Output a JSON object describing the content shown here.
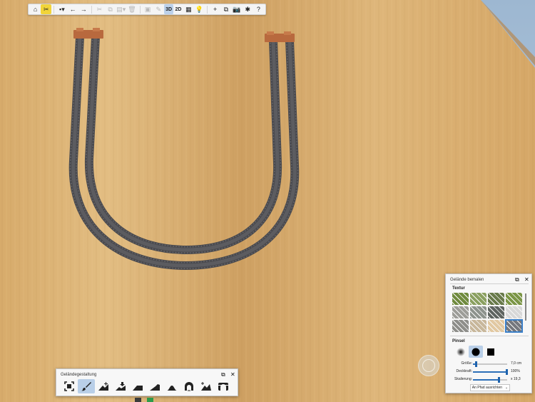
{
  "toolbar": {
    "items": [
      {
        "name": "home-icon",
        "glyph": "⌂"
      },
      {
        "name": "tools-icon",
        "glyph": "✂",
        "active": true
      },
      {
        "name": "save-icon",
        "glyph": "▪▾"
      },
      {
        "name": "undo-icon",
        "glyph": "←"
      },
      {
        "name": "redo-icon",
        "glyph": "→"
      },
      {
        "name": "cut-icon",
        "glyph": "✂"
      },
      {
        "name": "copy-icon",
        "glyph": "⧉"
      },
      {
        "name": "paste-icon",
        "glyph": "▤▾"
      },
      {
        "name": "delete-icon",
        "glyph": "🗑"
      },
      {
        "name": "group-icon",
        "glyph": "▣"
      },
      {
        "name": "pen-icon",
        "glyph": "✎"
      }
    ],
    "view_3d": "3D",
    "view_2d": "2D",
    "right_items": [
      {
        "name": "grid-icon",
        "glyph": "▦"
      },
      {
        "name": "bulb-icon",
        "glyph": "💡"
      },
      {
        "name": "add-icon",
        "glyph": "+"
      },
      {
        "name": "window-icon",
        "glyph": "⧉"
      },
      {
        "name": "camera-icon",
        "glyph": "📷"
      },
      {
        "name": "puzzle-icon",
        "glyph": "✱"
      },
      {
        "name": "help-icon",
        "glyph": "?"
      }
    ]
  },
  "terrain_panel": {
    "title": "Geländegestaltung",
    "tools": [
      {
        "name": "select-area-tool"
      },
      {
        "name": "paint-brush-tool",
        "active": true
      },
      {
        "name": "raise-terrain-tool"
      },
      {
        "name": "lower-terrain-tool"
      },
      {
        "name": "flatten-terrain-tool"
      },
      {
        "name": "slope-terrain-tool"
      },
      {
        "name": "smooth-hill-tool"
      },
      {
        "name": "tunnel-tool"
      },
      {
        "name": "mountain-tool"
      },
      {
        "name": "tunnel-portal-tool"
      }
    ]
  },
  "paint_panel": {
    "title": "Gelände bemalen",
    "texture_label": "Textur",
    "textures": [
      {
        "name": "grass-dark",
        "color": "#6f8a3d"
      },
      {
        "name": "grass-light",
        "color": "#8aa060"
      },
      {
        "name": "moss",
        "color": "#687a4a"
      },
      {
        "name": "meadow",
        "color": "#7b9646"
      },
      {
        "name": "gravel",
        "color": "#9d9d98"
      },
      {
        "name": "rock",
        "color": "#8d938d"
      },
      {
        "name": "gravel-dark",
        "color": "#5e6460"
      },
      {
        "name": "snow",
        "color": "#d8d8d8"
      },
      {
        "name": "stone",
        "color": "#8e8e8a"
      },
      {
        "name": "sand",
        "color": "#c8b79b"
      },
      {
        "name": "sand-light",
        "color": "#e2c9a2"
      },
      {
        "name": "asphalt",
        "color": "#75777d",
        "selected": true
      }
    ],
    "brush_label": "Pinsel",
    "brushes": [
      {
        "name": "soft-brush-icon"
      },
      {
        "name": "round-brush-icon",
        "active": true
      },
      {
        "name": "square-brush-icon"
      }
    ],
    "size": {
      "label": "Größe:",
      "value": "7,0 cm",
      "fraction": 0.08
    },
    "opacity": {
      "label": "Deckkraft:",
      "value": "100%",
      "fraction": 0.98
    },
    "scale": {
      "label": "Skalierung:",
      "value": "x 19,3",
      "fraction": 0.74
    },
    "align_label": "An Pfad ausrichten",
    "dropdown_glyph": "⌄"
  },
  "colors": {
    "wood": "#d3a96a",
    "track": "#4a4a4e",
    "buffer": "#b86a3e",
    "accent": "#2c6fb8"
  }
}
